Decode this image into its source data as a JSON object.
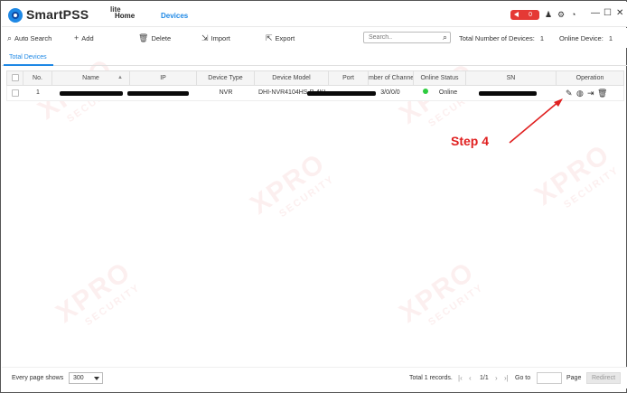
{
  "app": {
    "logo_text": "SmartPSS",
    "logo_suffix": "lite",
    "nav": {
      "home": "Home",
      "devices": "Devices"
    },
    "alarm_count": "0",
    "colors": {
      "accent": "#1e88e5",
      "alarm": "#e53935",
      "online": "#2ecc40",
      "annotation": "#e02020"
    }
  },
  "toolbar": {
    "auto_search": "Auto Search",
    "add": "Add",
    "delete": "Delete",
    "import": "Import",
    "export": "Export",
    "search_placeholder": "Search..",
    "total_label": "Total Number of Devices:",
    "total_value": "1",
    "online_label": "Online Device:",
    "online_value": "1"
  },
  "tabs": {
    "active": "Total Devices"
  },
  "table": {
    "columns": {
      "no": "No.",
      "name": "Name",
      "ip": "IP",
      "device_type": "Device Type",
      "device_model": "Device Model",
      "port": "Port",
      "channels": "Number of Channels",
      "online_status": "Online Status",
      "sn": "SN",
      "operation": "Operation"
    },
    "rows": [
      {
        "no": "1",
        "device_type": "NVR",
        "device_model": "DHI-NVR4104HS-P-4KS2",
        "channels": "3/0/0/0",
        "online_status": "Online"
      }
    ]
  },
  "annotation": {
    "label": "Step 4"
  },
  "watermark": {
    "big": "XPRO",
    "small": "SECURITY"
  },
  "footer": {
    "every_page_label": "Every page shows",
    "page_size": "300",
    "records": "Total 1 records.",
    "page_indicator": "1/1",
    "goto_label": "Go to",
    "page_label": "Page",
    "redirect": "Redirect"
  }
}
